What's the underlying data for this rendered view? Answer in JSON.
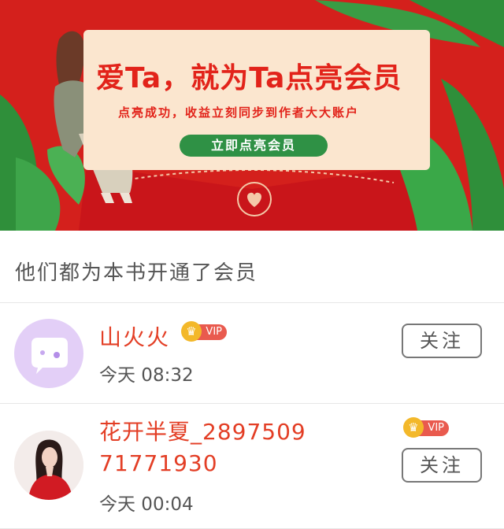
{
  "banner": {
    "headline": "爱Ta，就为Ta点亮会员",
    "subline": "点亮成功，收益立刻同步到作者大大账户",
    "cta_label": "立即点亮会员"
  },
  "section": {
    "title": "他们都为本书开通了会员"
  },
  "members": [
    {
      "name": "山火火",
      "badge": "VIP",
      "time": "今天 08:32",
      "follow_label": "关注"
    },
    {
      "name": "花开半夏_289750971771930",
      "badge": "VIP",
      "time": "今天 00:04",
      "follow_label": "关注"
    }
  ],
  "colors": {
    "banner_red": "#d4201c",
    "card_cream": "#fbe6cf",
    "cta_green": "#2f9145",
    "name_red": "#e33e25",
    "vip_red": "#e95a4e",
    "crown_gold": "#f3b82a"
  },
  "icons": [
    "heart-seal-icon",
    "crown-icon",
    "chat-bubble-avatar-icon"
  ]
}
